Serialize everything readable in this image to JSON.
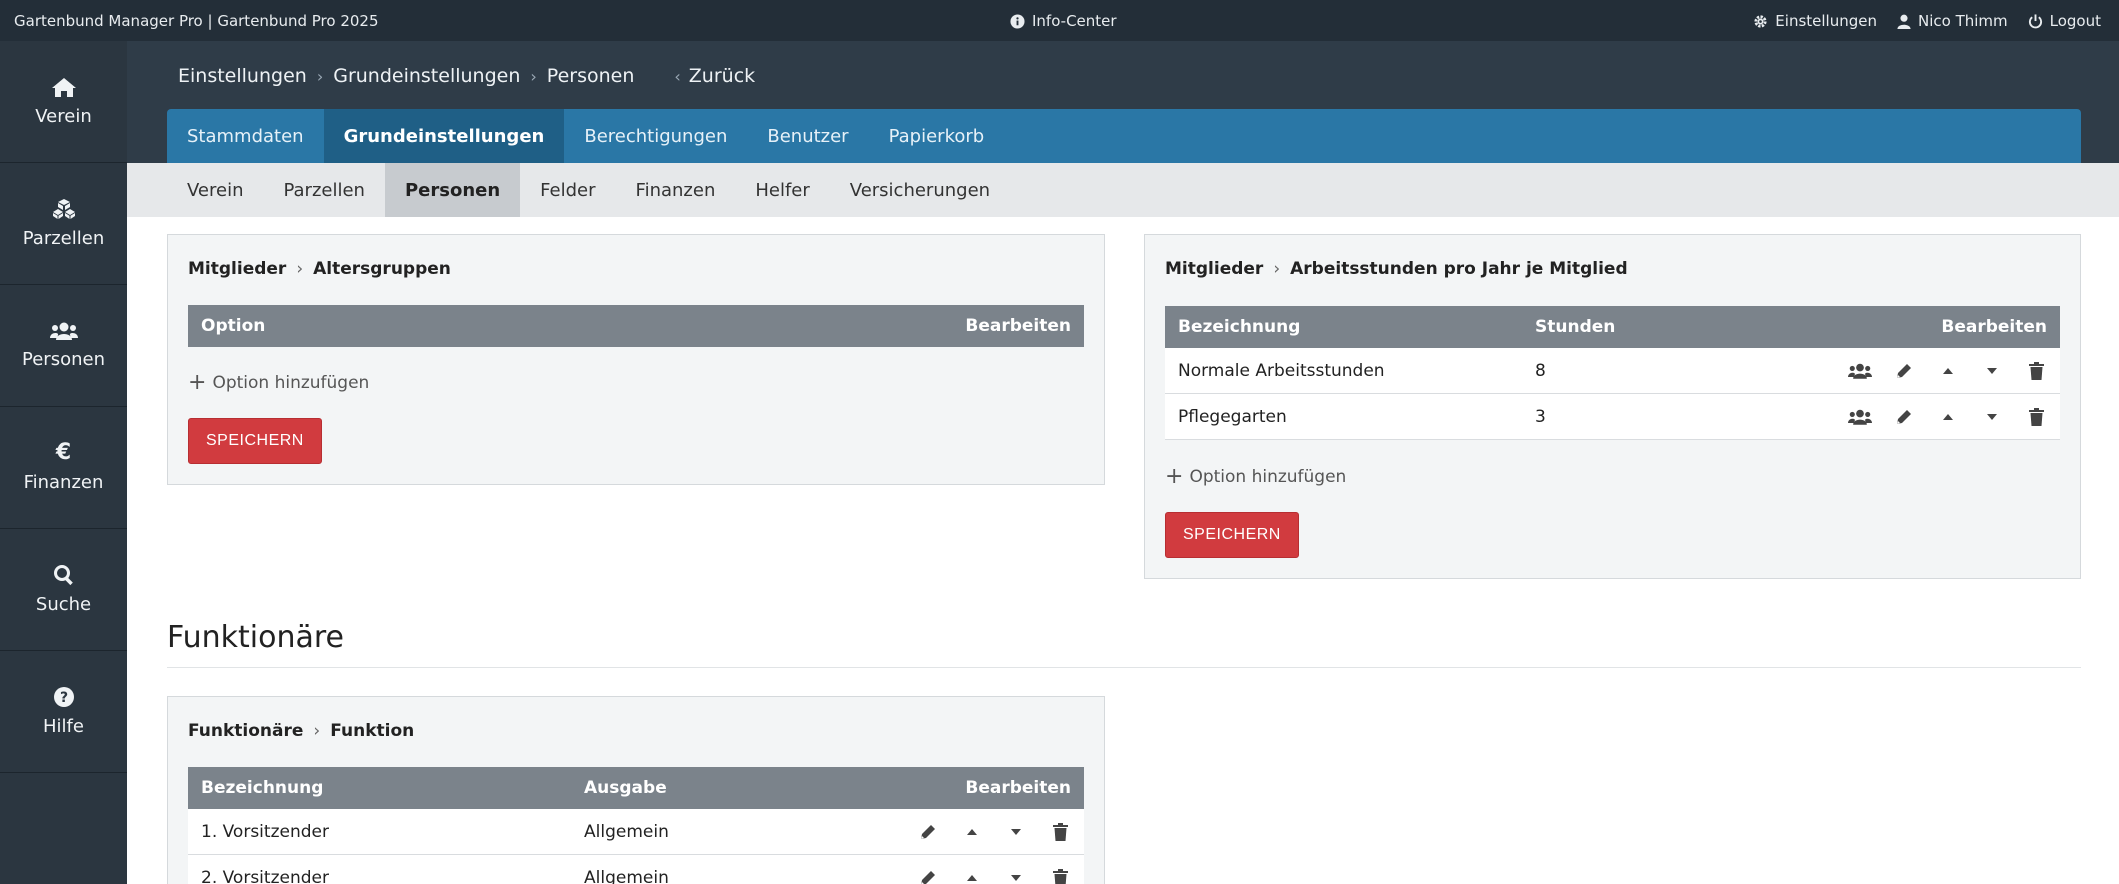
{
  "topbar": {
    "app_title": "Gartenbund Manager Pro | Gartenbund Pro 2025",
    "info_center": "Info-Center",
    "settings": "Einstellungen",
    "user": "Nico Thimm",
    "logout": "Logout"
  },
  "sidebar": {
    "items": [
      {
        "label": "Verein",
        "icon": "home-icon"
      },
      {
        "label": "Parzellen",
        "icon": "parcels-icon"
      },
      {
        "label": "Personen",
        "icon": "users-icon"
      },
      {
        "label": "Finanzen",
        "icon": "euro-icon"
      },
      {
        "label": "Suche",
        "icon": "search-icon"
      },
      {
        "label": "Hilfe",
        "icon": "help-icon"
      }
    ]
  },
  "breadcrumb": {
    "items": [
      "Einstellungen",
      "Grundeinstellungen",
      "Personen"
    ],
    "back": "Zurück"
  },
  "main_tabs": [
    "Stammdaten",
    "Grundeinstellungen",
    "Berechtigungen",
    "Benutzer",
    "Papierkorb"
  ],
  "main_tab_active": "Grundeinstellungen",
  "sub_tabs": [
    "Verein",
    "Parzellen",
    "Personen",
    "Felder",
    "Finanzen",
    "Helfer",
    "Versicherungen"
  ],
  "sub_tab_active": "Personen",
  "panel_age": {
    "crumb1": "Mitglieder",
    "crumb2": "Altersgruppen",
    "col_option": "Option",
    "col_edit": "Bearbeiten",
    "add_option": "Option hinzufügen",
    "save": "SPEICHERN"
  },
  "panel_hours": {
    "crumb1": "Mitglieder",
    "crumb2": "Arbeitsstunden pro Jahr je Mitglied",
    "col_name": "Bezeichnung",
    "col_hours": "Stunden",
    "col_edit": "Bearbeiten",
    "rows": [
      {
        "name": "Normale Arbeitsstunden",
        "hours": "8"
      },
      {
        "name": "Pflegegarten",
        "hours": "3"
      }
    ],
    "add_option": "Option hinzufügen",
    "save": "SPEICHERN"
  },
  "section_title": "Funktionäre",
  "panel_functions": {
    "crumb1": "Funktionäre",
    "crumb2": "Funktion",
    "col_name": "Bezeichnung",
    "col_output": "Ausgabe",
    "col_edit": "Bearbeiten",
    "rows": [
      {
        "name": "1. Vorsitzender",
        "output": "Allgemein"
      },
      {
        "name": "2. Vorsitzender",
        "output": "Allgemein"
      }
    ]
  },
  "colors": {
    "topbar": "#232e38",
    "sidebar": "#2b3640",
    "main_tabs": "#2a77a6",
    "save_button": "#d13b3f",
    "table_header": "#7b838b"
  }
}
